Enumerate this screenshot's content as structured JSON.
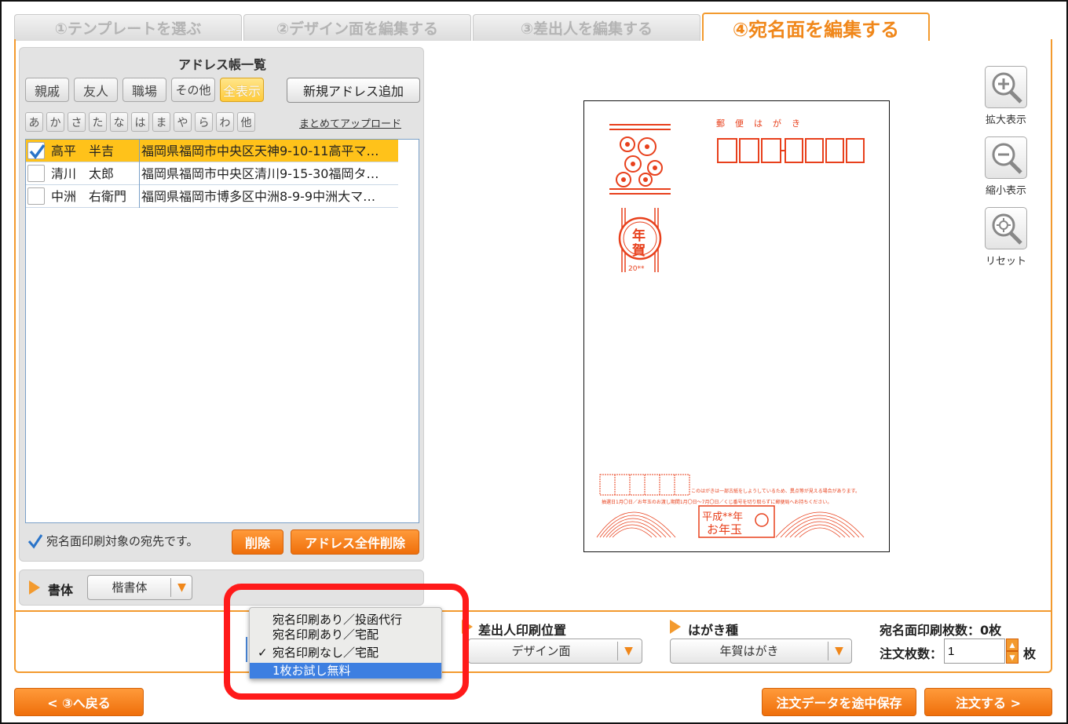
{
  "tabs": [
    {
      "label": "①テンプレートを選ぶ"
    },
    {
      "label": "②デザイン面を編集する"
    },
    {
      "label": "③差出人を編集する"
    },
    {
      "label": "④宛名面を編集する"
    }
  ],
  "address_book": {
    "title": "アドレス帳一覧",
    "groups": [
      "親戚",
      "友人",
      "職場",
      "その他",
      "全表示"
    ],
    "selected_group": "全表示",
    "new_address_button": "新規アドレス追加",
    "kana": [
      "あ",
      "か",
      "さ",
      "た",
      "な",
      "は",
      "ま",
      "や",
      "ら",
      "わ",
      "他"
    ],
    "bulk_upload_link": "まとめてアップロード",
    "rows": [
      {
        "name": "高平　半吉",
        "address": "福岡県福岡市中央区天神9-10-11高平マ…",
        "checked": true
      },
      {
        "name": "清川　太郎",
        "address": "福岡県福岡市中央区清川9-15-30福岡タ…",
        "checked": false
      },
      {
        "name": "中洲　右衛門",
        "address": "福岡県福岡市博多区中洲8-9-9中洲大マ…",
        "checked": false
      }
    ],
    "note": "宛名面印刷対象の宛先です。",
    "delete_button": "削除",
    "delete_all_button": "アドレス全件削除"
  },
  "font": {
    "label": "書体",
    "value": "楷書体"
  },
  "sender_position": {
    "label": "差出人印刷位置",
    "value": "デザイン面"
  },
  "card_type": {
    "label": "はがき種",
    "value": "年賀はがき"
  },
  "print_count": {
    "label": "宛名面印刷枚数：0枚"
  },
  "order_qty": {
    "label": "注文枚数：",
    "value": "1",
    "unit": "枚"
  },
  "print_option_menu": {
    "items": [
      {
        "label": "宛名印刷あり／投函代行",
        "checked": false
      },
      {
        "label": "宛名印刷あり／宅配",
        "checked": false
      },
      {
        "label": "宛名印刷なし／宅配",
        "checked": true
      },
      {
        "label": "1枚お試し無料",
        "highlighted": true
      }
    ],
    "check_mark": "✓"
  },
  "zoom_tools": [
    {
      "label": "拡大表示",
      "icon": "zoom-in-icon"
    },
    {
      "label": "縮小表示",
      "icon": "zoom-out-icon"
    },
    {
      "label": "リセット",
      "icon": "reset-icon"
    }
  ],
  "postcard": {
    "postal_label": "郵　便　は　が　き",
    "nenga_top": "年",
    "nenga_bottom": "賀",
    "year": "20**",
    "lottery_line1": "このはがきは一部古紙をしようしているため、異点等が見える場合があります。",
    "lottery_line2": "抽選日1月〇日／お年玉のお渡し期間1月〇日〜7月〇日／くじ番号を切り取らずに郵便局へお持ちください。",
    "otoshidama_line1": "平成**年",
    "otoshidama_line2": "お年玉",
    "stamp_color": "#e8401c"
  },
  "footer": {
    "back_button": "< ③へ戻る",
    "save_button": "注文データを途中保存",
    "order_button": "注文する >"
  },
  "colors": {
    "accent": "#f39a2e",
    "button_orange": "#ef6f0b",
    "highlight_row": "#ffc21a",
    "annotation_ring": "#ff1a1a"
  }
}
